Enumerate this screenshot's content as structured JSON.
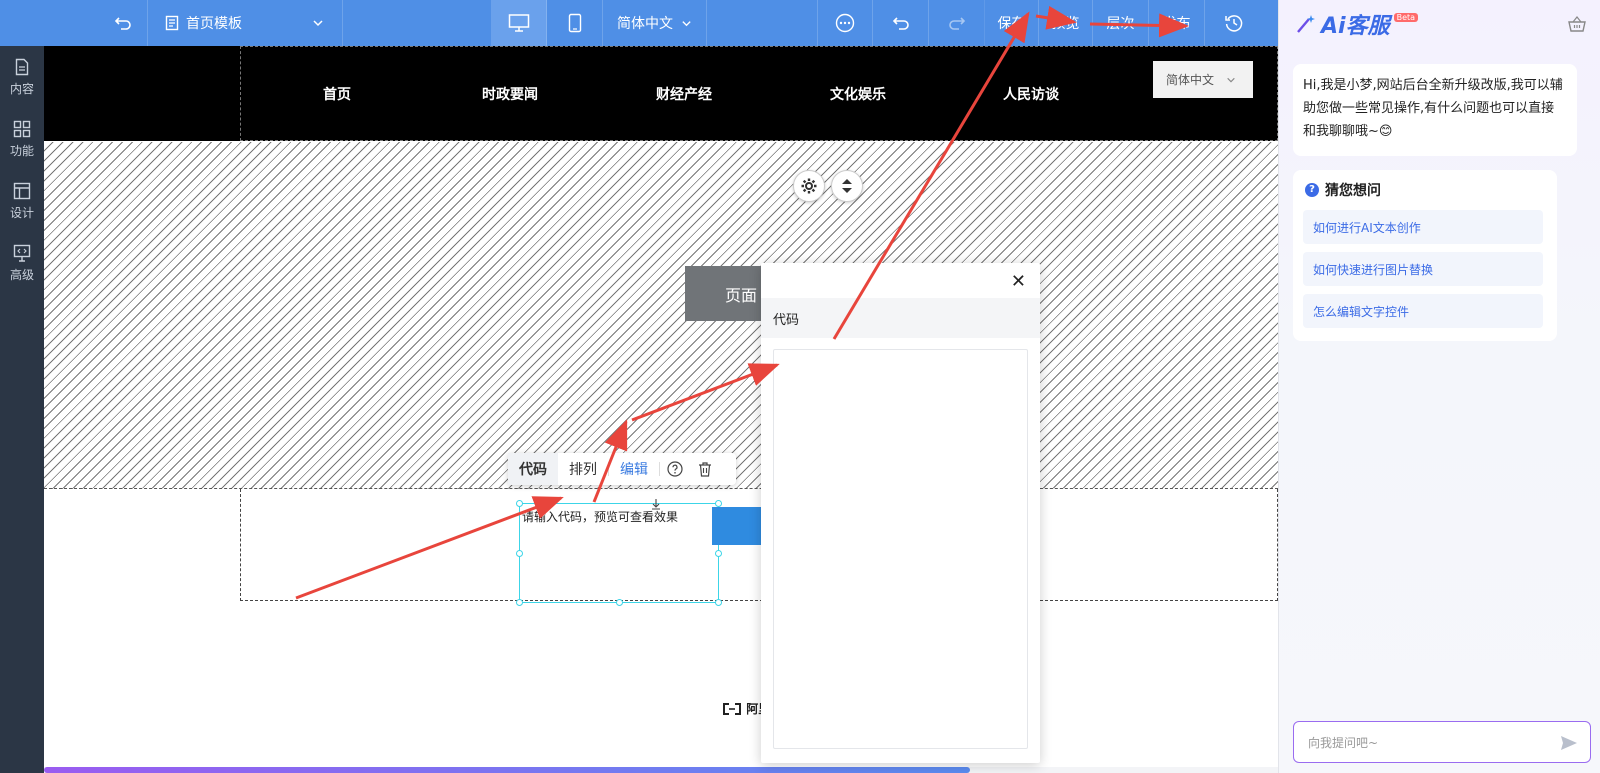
{
  "topbar": {
    "template_label": "首页模板",
    "language": "简体中文",
    "save": "保存",
    "preview": "预览",
    "layers": "层次",
    "publish": "发布"
  },
  "sidebar": {
    "items": [
      {
        "label": "内容",
        "icon": "document-icon"
      },
      {
        "label": "功能",
        "icon": "grid-icon"
      },
      {
        "label": "设计",
        "icon": "layout-icon"
      },
      {
        "label": "高级",
        "icon": "code-monitor-icon"
      }
    ]
  },
  "site": {
    "nav": [
      "首页",
      "时政要闻",
      "财经产经",
      "文化娱乐",
      "人民访谈"
    ],
    "lang_select": "简体中文",
    "page_button": "页面"
  },
  "component_toolbar": {
    "code": "代码",
    "arrange": "排列",
    "edit": "编辑"
  },
  "code_widget": {
    "hint": "请输入代码，预览可查看效果"
  },
  "footer": {
    "logo_text": "阿里"
  },
  "progress": {
    "percent": 75
  },
  "modal": {
    "tab_label": "代码"
  },
  "ai_panel": {
    "title": "Ai客服",
    "badge": "Beta",
    "greeting": "Hi,我是小梦,网站后台全新升级改版,我可以辅助您做一些常见操作,有什么问题也可以直接和我聊聊哦~😊",
    "guess_title": "猜您想问",
    "questions": [
      "如何进行AI文本创作",
      "如何快速进行图片替换",
      "怎么编辑文字控件"
    ],
    "input_placeholder": "向我提问吧~"
  },
  "colors": {
    "topbar": "#4f8fe6",
    "sidebar": "#2b3645",
    "accent": "#3b6be6",
    "annotation_arrow": "#e8453c"
  }
}
